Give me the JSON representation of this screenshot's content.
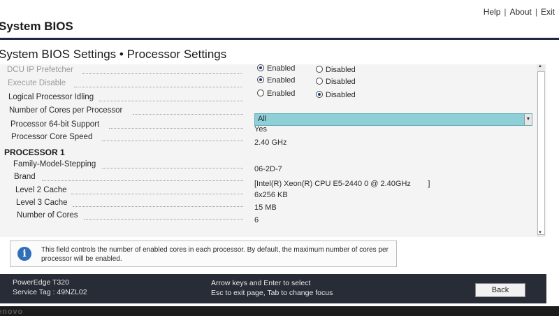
{
  "header": {
    "links": [
      "Help",
      "About",
      "Exit"
    ],
    "app_title": "System BIOS",
    "page_title": "System BIOS Settings • Processor Settings"
  },
  "settings": [
    {
      "label": "DCU IP Prefetcher",
      "type": "radio",
      "options": [
        "Enabled",
        "Disabled"
      ],
      "selected": "Enabled",
      "dim": true
    },
    {
      "label": "Execute Disable",
      "type": "radio",
      "options": [
        "Enabled",
        "Disabled"
      ],
      "selected": "Enabled",
      "dim": true
    },
    {
      "label": "Logical Processor Idling",
      "type": "radio",
      "options": [
        "Enabled",
        "Disabled"
      ],
      "selected": "Disabled",
      "dim": false
    },
    {
      "label": "Number of Cores per Processor",
      "type": "select",
      "value": "All",
      "dim": false
    },
    {
      "label": "Processor 64-bit Support",
      "type": "text",
      "value": "Yes",
      "dim": false
    },
    {
      "label": "Processor Core Speed",
      "type": "text",
      "value": "2.40 GHz",
      "dim": false
    }
  ],
  "processor1": {
    "heading": "PROCESSOR 1",
    "rows": [
      {
        "label": "Family-Model-Stepping",
        "value": "06-2D-7"
      },
      {
        "label": "Brand",
        "value": "[Intel(R) Xeon(R) CPU E5-2440 0 @ 2.40GHz        ]"
      },
      {
        "label": "Level 2 Cache",
        "value": "6x256 KB"
      },
      {
        "label": "Level 3 Cache",
        "value": "15 MB"
      },
      {
        "label": "Number of Cores",
        "value": "6"
      }
    ]
  },
  "help": {
    "icon": "info-icon",
    "text": "This field controls the number of enabled cores in each processor. By default, the maximum number of cores per processor will be enabled."
  },
  "footer": {
    "model": "PowerEdge T320",
    "service_tag": "Service Tag : 49NZL02",
    "hint1": "Arrow keys and Enter to select",
    "hint2": "Esc to exit page, Tab to change focus",
    "back_label": "Back"
  },
  "bezel": {
    "brand": "enovo"
  },
  "colors": {
    "accent_select": "#8fd0d8",
    "footer_bg": "#272c36",
    "header_line": "#1f2a44",
    "info_icon": "#2f6fb8"
  }
}
